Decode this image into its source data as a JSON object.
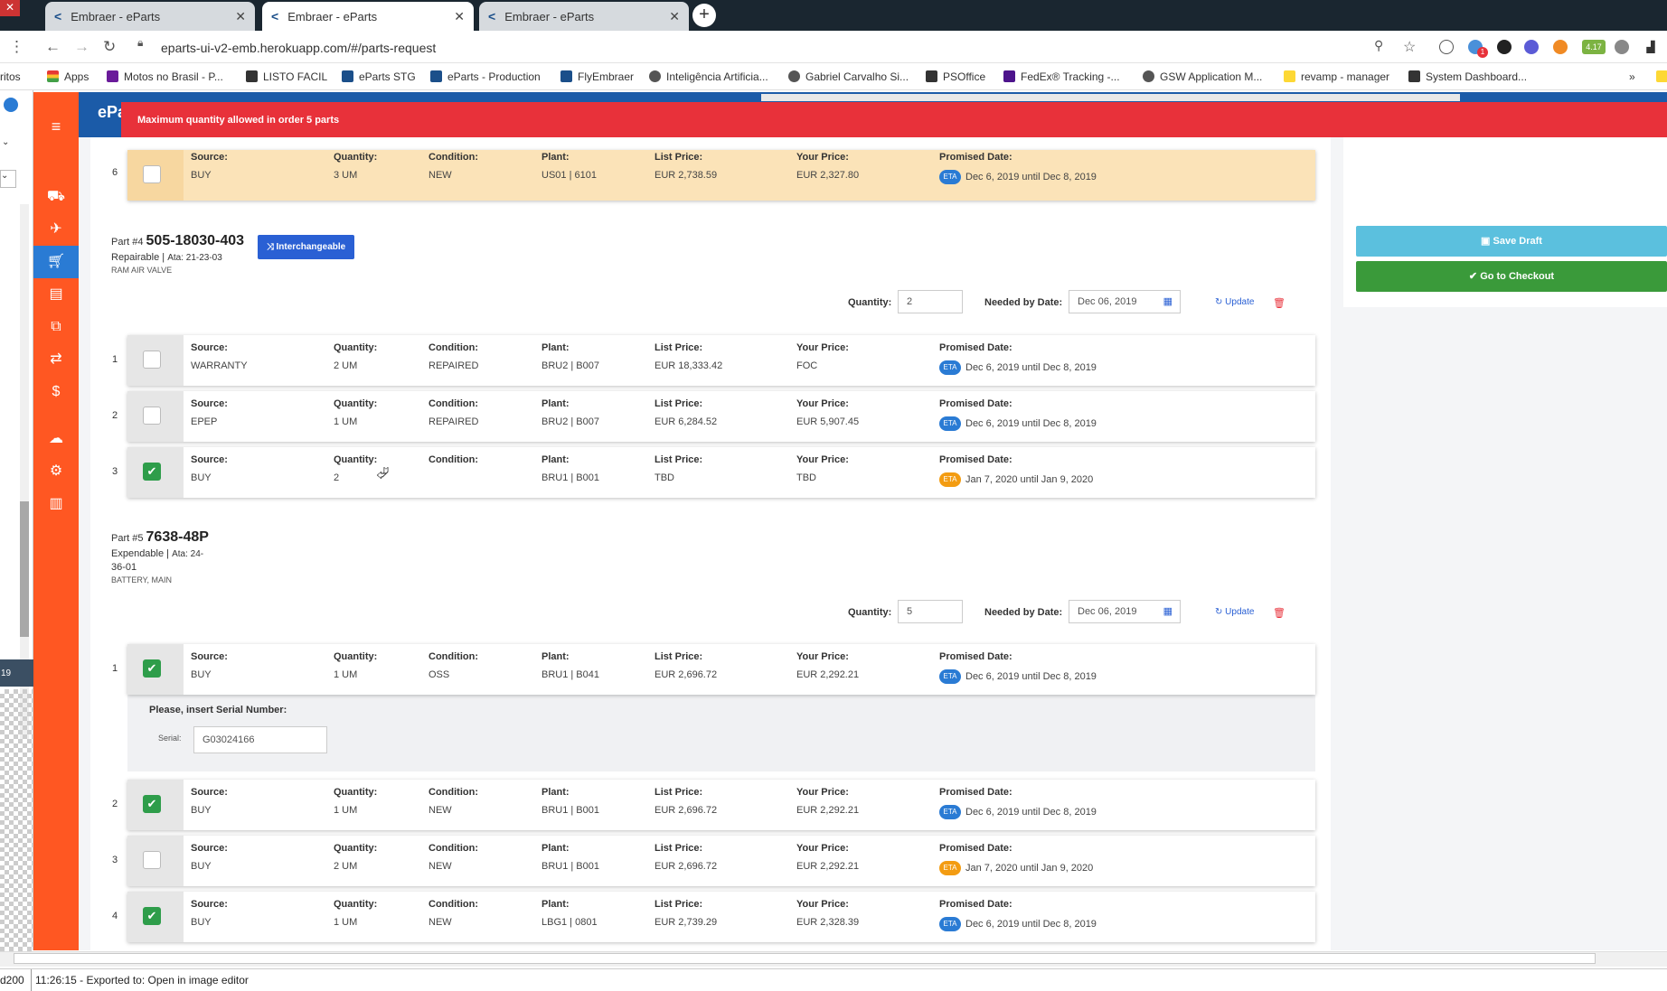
{
  "browser": {
    "tabs": [
      {
        "label": "Embraer - eParts"
      },
      {
        "label": "Embraer - eParts"
      },
      {
        "label": "Embraer - eParts"
      }
    ],
    "url": "eparts-ui-v2-emb.herokuapp.com/#/parts-request",
    "bookmarks": [
      "Apps",
      "Motos no Brasil - P...",
      "LISTO FACIL",
      "eParts STG",
      "eParts - Production",
      "FlyEmbraer",
      "Inteligência Artificia...",
      "Gabriel Carvalho Si...",
      "PSOffice",
      "FedEx® Tracking -...",
      "GSW Application M...",
      "revamp - manager",
      "System Dashboard..."
    ],
    "left_partial": "ritos",
    "ext_badge": "4.17",
    "ext_badge2": "1"
  },
  "app": {
    "brand": "ePa",
    "alert": "Maximum quantity allowed in order 5 parts",
    "save_draft": "Save Draft",
    "go_checkout": "Go to Checkout"
  },
  "labels": {
    "source": "Source:",
    "quantity": "Quantity:",
    "condition": "Condition:",
    "plant": "Plant:",
    "list_price": "List Price:",
    "your_price": "Your Price:",
    "promised_date": "Promised Date:",
    "eta": "ETA",
    "qty_ctrl": "Quantity:",
    "needed_by": "Needed by Date:",
    "update": "Update",
    "serial_prompt": "Please, insert Serial Number:",
    "serial": "Serial:"
  },
  "top_row": {
    "num": "6",
    "source": "BUY",
    "quantity": "3 UM",
    "condition": "NEW",
    "plant": "US01 | 6101",
    "list_price": "EUR 2,738.59",
    "your_price": "EUR 2,327.80",
    "promised": "Dec 6, 2019 until Dec 8, 2019"
  },
  "part4": {
    "prefix": "Part #4",
    "number": "505-18030-403",
    "type": "Repairable",
    "ata": "Ata: 21-23-03",
    "description": "RAM AIR VALVE",
    "interchangeable": "Interchangeable",
    "quantity": "2",
    "needed_by": "Dec 06, 2019",
    "rows": [
      {
        "num": "1",
        "source": "WARRANTY",
        "quantity": "2 UM",
        "condition": "REPAIRED",
        "plant": "BRU2 | B007",
        "list_price": "EUR 18,333.42",
        "your_price": "FOC",
        "promised": "Dec 6, 2019 until Dec 8, 2019"
      },
      {
        "num": "2",
        "source": "EPEP",
        "quantity": "1 UM",
        "condition": "REPAIRED",
        "plant": "BRU2 | B007",
        "list_price": "EUR 6,284.52",
        "your_price": "EUR 5,907.45",
        "promised": "Dec 6, 2019 until Dec 8, 2019"
      },
      {
        "num": "3",
        "source": "BUY",
        "quantity": "2",
        "condition": "",
        "plant": "BRU1 | B001",
        "list_price": "TBD",
        "your_price": "TBD",
        "promised": "Jan 7, 2020 until Jan 9, 2020"
      }
    ]
  },
  "part5": {
    "prefix": "Part #5",
    "number": "7638-48P",
    "type": "Expendable",
    "ata_line1": "Ata: 24-",
    "ata_line2": "36-01",
    "description": "BATTERY, MAIN",
    "quantity": "5",
    "needed_by": "Dec 06, 2019",
    "serial_value": "G03024166",
    "rows": [
      {
        "num": "1",
        "source": "BUY",
        "quantity": "1 UM",
        "condition": "OSS",
        "plant": "BRU1 | B041",
        "list_price": "EUR 2,696.72",
        "your_price": "EUR 2,292.21",
        "promised": "Dec 6, 2019 until Dec 8, 2019"
      },
      {
        "num": "2",
        "source": "BUY",
        "quantity": "1 UM",
        "condition": "NEW",
        "plant": "BRU1 | B001",
        "list_price": "EUR 2,696.72",
        "your_price": "EUR 2,292.21",
        "promised": "Dec 6, 2019 until Dec 8, 2019"
      },
      {
        "num": "3",
        "source": "BUY",
        "quantity": "2 UM",
        "condition": "NEW",
        "plant": "BRU1 | B001",
        "list_price": "EUR 2,696.72",
        "your_price": "EUR 2,292.21",
        "promised": "Jan 7, 2020 until Jan 9, 2020"
      },
      {
        "num": "4",
        "source": "BUY",
        "quantity": "1 UM",
        "condition": "NEW",
        "plant": "LBG1 | 0801",
        "list_price": "EUR 2,739.29",
        "your_price": "EUR 2,328.39",
        "promised": "Dec 6, 2019 until Dec 8, 2019"
      }
    ]
  },
  "statusbar": {
    "left": "d200",
    "text": "11:26:15 - Exported to: Open in image editor",
    "side_num": "19"
  }
}
